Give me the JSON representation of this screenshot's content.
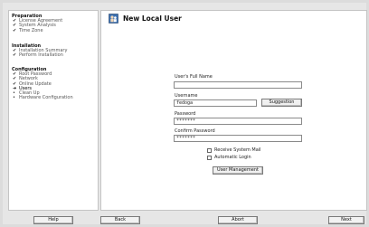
{
  "sidebar": {
    "sections": [
      {
        "title": "Preparation",
        "steps": [
          {
            "label": "License Agreement",
            "state": "done"
          },
          {
            "label": "System Analysis",
            "state": "done"
          },
          {
            "label": "Time Zone",
            "state": "done"
          }
        ]
      },
      {
        "title": "Installation",
        "steps": [
          {
            "label": "Installation Summary",
            "state": "done"
          },
          {
            "label": "Perform Installation",
            "state": "done"
          }
        ]
      },
      {
        "title": "Configuration",
        "steps": [
          {
            "label": "Root Password",
            "state": "done"
          },
          {
            "label": "Network",
            "state": "done"
          },
          {
            "label": "Online Update",
            "state": "done"
          },
          {
            "label": "Users",
            "state": "current"
          },
          {
            "label": "Clean Up",
            "state": "pending"
          },
          {
            "label": "Hardware Configuration",
            "state": "pending"
          }
        ]
      }
    ]
  },
  "header": {
    "title": "New Local User"
  },
  "form": {
    "full_name_label": "User's Full Name",
    "full_name_value": "",
    "username_label": "Username",
    "username_value": "fedoga",
    "suggestion_button": "Suggestion",
    "password_label": "Password",
    "password_value": "*******",
    "confirm_label": "Confirm Password",
    "confirm_value": "*******",
    "receive_mail_label": "Receive System Mail",
    "auto_login_label": "Automatic Login",
    "user_management_button": "User Management"
  },
  "footer": {
    "help": "Help",
    "back": "Back",
    "abort": "Abort",
    "next": "Next"
  }
}
